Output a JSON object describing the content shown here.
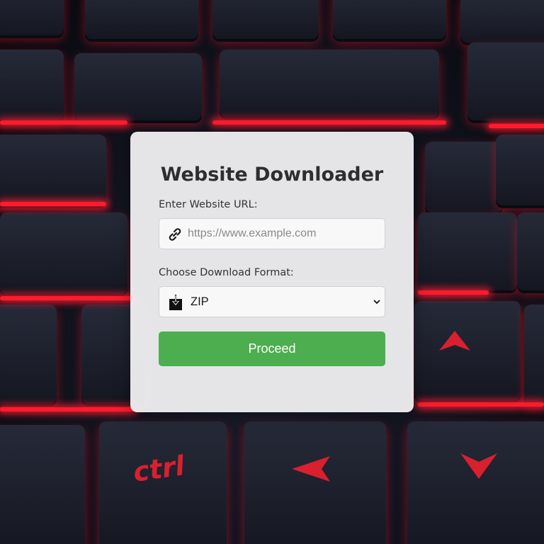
{
  "background": {
    "keycaps": {
      "ctrl": "ctrl"
    },
    "accent_color": "#ff1b2e"
  },
  "form": {
    "title": "Website Downloader",
    "url_label": "Enter Website URL:",
    "url_placeholder": "https://www.example.com",
    "url_value": "",
    "url_icon": "link-icon",
    "format_label": "Choose Download Format:",
    "format_selected": "ZIP",
    "format_icon": "download-icon",
    "proceed_label": "Proceed",
    "button_color": "#4cae4f"
  }
}
